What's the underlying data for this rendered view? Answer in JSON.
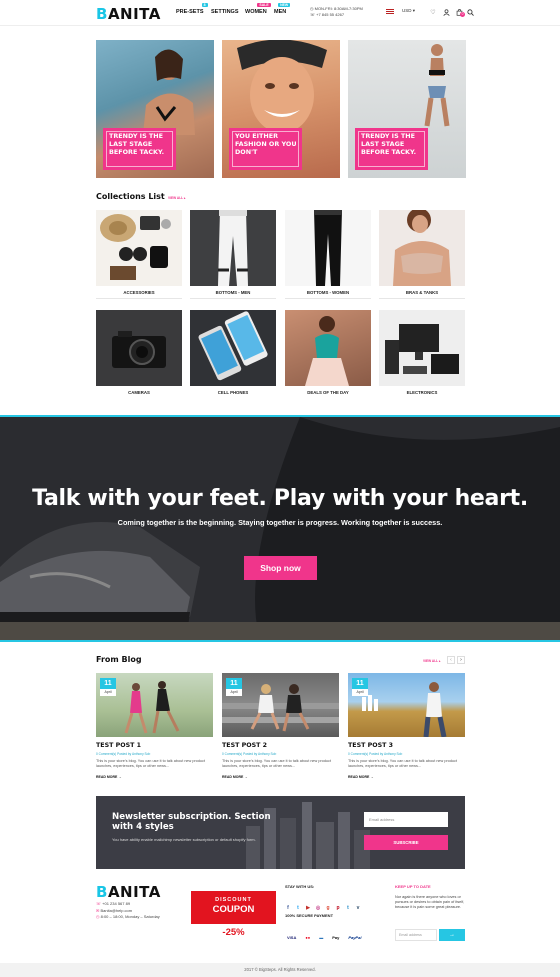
{
  "header": {
    "logo_first": "B",
    "logo_rest": "ANITA",
    "nav": [
      {
        "label": "PRE-SETS",
        "badge": "8",
        "badge_color": "#26c6e3"
      },
      {
        "label": "SETTINGS",
        "badge": "",
        "badge_color": ""
      },
      {
        "label": "WOMEN",
        "badge": "SALE",
        "badge_color": "#f0358b"
      },
      {
        "label": "MEN",
        "badge": "NEW",
        "badge_color": "#26c6e3"
      }
    ],
    "hours": "MON-FRI: 8:30AM-7:30PM",
    "phone": "+7 845 55 4267",
    "currency": "USD",
    "cart_count": "0"
  },
  "hero": [
    {
      "caption": "TRENDY IS THE LAST STAGE BEFORE TACKY."
    },
    {
      "caption": "YOU EITHER FASHION OR YOU DON'T"
    },
    {
      "caption": "TRENDY IS THE LAST STAGE BEFORE TACKY."
    }
  ],
  "collections": {
    "title": "Collections List",
    "view_all": "VIEW ALL",
    "items": [
      {
        "label": "ACCESSORIES"
      },
      {
        "label": "BOTTOMS - MEN"
      },
      {
        "label": "BOTTOMS - WOMEN"
      },
      {
        "label": "BRAS & TANKS"
      },
      {
        "label": "CAMERAS"
      },
      {
        "label": "CELL PHONES"
      },
      {
        "label": "DEALS OF THE DAY"
      },
      {
        "label": "ELECTRONICS"
      }
    ]
  },
  "banner": {
    "headline": "Talk with your feet. Play with your heart.",
    "subline": "Coming together is the beginning. Staying together is progress. Working together is success.",
    "button": "Shop now"
  },
  "blog": {
    "title": "From Blog",
    "view_all": "VIEW ALL",
    "posts": [
      {
        "day": "11",
        "month": "April",
        "title": "TEST POST 1",
        "meta": "0 Comment(s) Posted by Anthony Sob",
        "excerpt": "This is your store's blog. You can use it to talk about new product launches, experiences, tips or other news...",
        "read_more": "READ MORE →"
      },
      {
        "day": "11",
        "month": "April",
        "title": "TEST POST 2",
        "meta": "0 Comment(s) Posted by Anthony Sob",
        "excerpt": "This is your store's blog. You can use it to talk about new product launches, experiences, tips or other news...",
        "read_more": "READ MORE →"
      },
      {
        "day": "11",
        "month": "April",
        "title": "TEST POST 3",
        "meta": "0 Comment(s) Posted by Anthony Sob",
        "excerpt": "This is your store's blog. You can use it to talk about new product launches, experiences, tips or other news...",
        "read_more": "READ MORE →"
      }
    ]
  },
  "newsletter": {
    "title": "Newsletter subscription. Section with 4 styles",
    "text": "You have ability enable mailchimp newsletter subscription or default shopify form.",
    "placeholder": "Email address",
    "button": "SUBSCRIBE"
  },
  "footer": {
    "logo_first": "B",
    "logo_rest": "ANITA",
    "phone": "+01 234 567 89",
    "email": "Banita@help.com",
    "hours": "8:00 – 18:00, Monday – Saturday",
    "coupon_top": "DISCOUNT",
    "coupon_main": "COUPON",
    "coupon_pct": "-25%",
    "stay_title": "STAY WITH US:",
    "secure_title": "100% SECURE PAYMENT",
    "payments": [
      "VISA",
      "●●",
      "▬",
      "Pay",
      "PayPal"
    ],
    "keep_title": "KEEP UP TO DATE",
    "keep_text": "Nor again is there anyone who loves or pursues or desires to obtain pain of itself, because it is pain some great pleasure.",
    "keep_placeholder": "Email address",
    "copyright": "2017 © BigSteps. All Rights Reserved."
  }
}
